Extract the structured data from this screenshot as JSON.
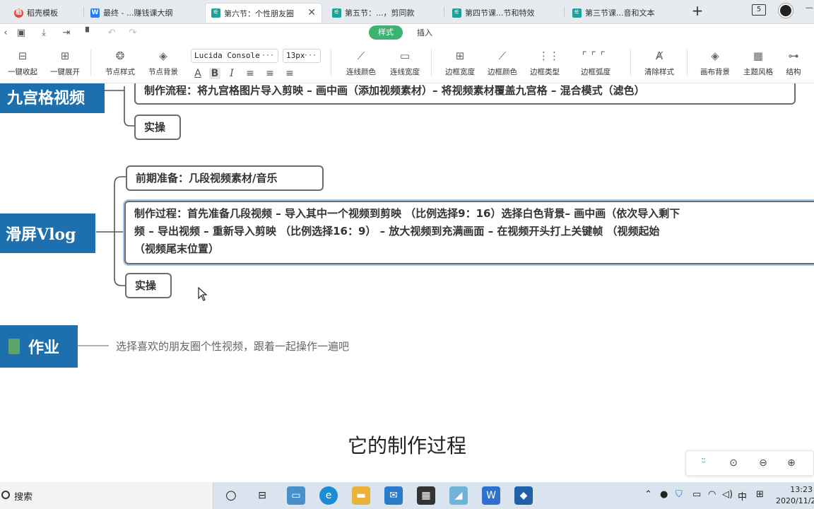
{
  "tabs": [
    {
      "label": "稻壳模板",
      "icon": "daoke-icon",
      "color": "#e8453c",
      "active": false
    },
    {
      "label": "最终 - ...赚钱课大纲",
      "icon": "doc-w-icon",
      "color": "#2b7ce9",
      "active": false
    },
    {
      "label": "第六节：个性朋友圈",
      "icon": "mindmap-icon",
      "color": "#1aa39a",
      "active": true
    },
    {
      "label": "第五节：...，剪同款",
      "icon": "mindmap-icon",
      "color": "#1aa39a",
      "active": false
    },
    {
      "label": "第四节课...节和特效",
      "icon": "mindmap-icon",
      "color": "#1aa39a",
      "active": false
    },
    {
      "label": "第三节课...音和文本",
      "icon": "mindmap-icon",
      "color": "#1aa39a",
      "active": false
    }
  ],
  "window": {
    "tab_count": "5",
    "new_tab": "+",
    "minimize": "—"
  },
  "modes": {
    "style": "样式",
    "insert": "插入"
  },
  "ribbon": {
    "collapse_all": "一键收起",
    "expand_all": "一键展开",
    "node_style": "节点样式",
    "node_bg": "节点背景",
    "font_family": "Lucida Console",
    "font_size": "13px",
    "line_color": "连线颜色",
    "line_width": "连线宽度",
    "border_width": "边框宽度",
    "border_color": "边框颜色",
    "border_type": "边框类型",
    "border_radius": "边框弧度",
    "clear_style": "清除样式",
    "canvas_bg": "画布背景",
    "theme": "主题风格",
    "structure": "结构"
  },
  "mindmap": {
    "topic_grid": "九宫格视频",
    "grid_process": "制作流程：将九宫格图片导入剪映 – 画中画（添加视频素材）– 将视频素材覆盖九宫格 – 混合模式（滤色）",
    "grid_practice": "实操",
    "topic_vlog": "滑屏Vlog",
    "vlog_prep": "前期准备：几段视频素材/音乐",
    "vlog_process_1": "制作过程：首先准备几段视频 – 导入其中一个视频到剪映 （比例选择9：16）选择白色背景– 画中画（依次导入剩下",
    "vlog_process_2": "频 – 导出视频 – 重新导入剪映 （比例选择16：9） – 放大视频到充满画面 – 在视频开头打上关键帧 （视频起始",
    "vlog_process_3": "（视频尾末位置）",
    "vlog_practice": "实操",
    "topic_homework": "作业",
    "homework_text": "选择喜欢的朋友圈个性视频，跟着一起操作一遍吧"
  },
  "subtitle": "它的制作过程",
  "taskbar": {
    "search_label": "搜索",
    "ime": "中",
    "time": "13:23",
    "date": "2020/11/2"
  },
  "colors": {
    "topic_blue": "#1e6fae",
    "accent_green": "#3cb371",
    "taskbar_bg": "#d9e4ef"
  }
}
